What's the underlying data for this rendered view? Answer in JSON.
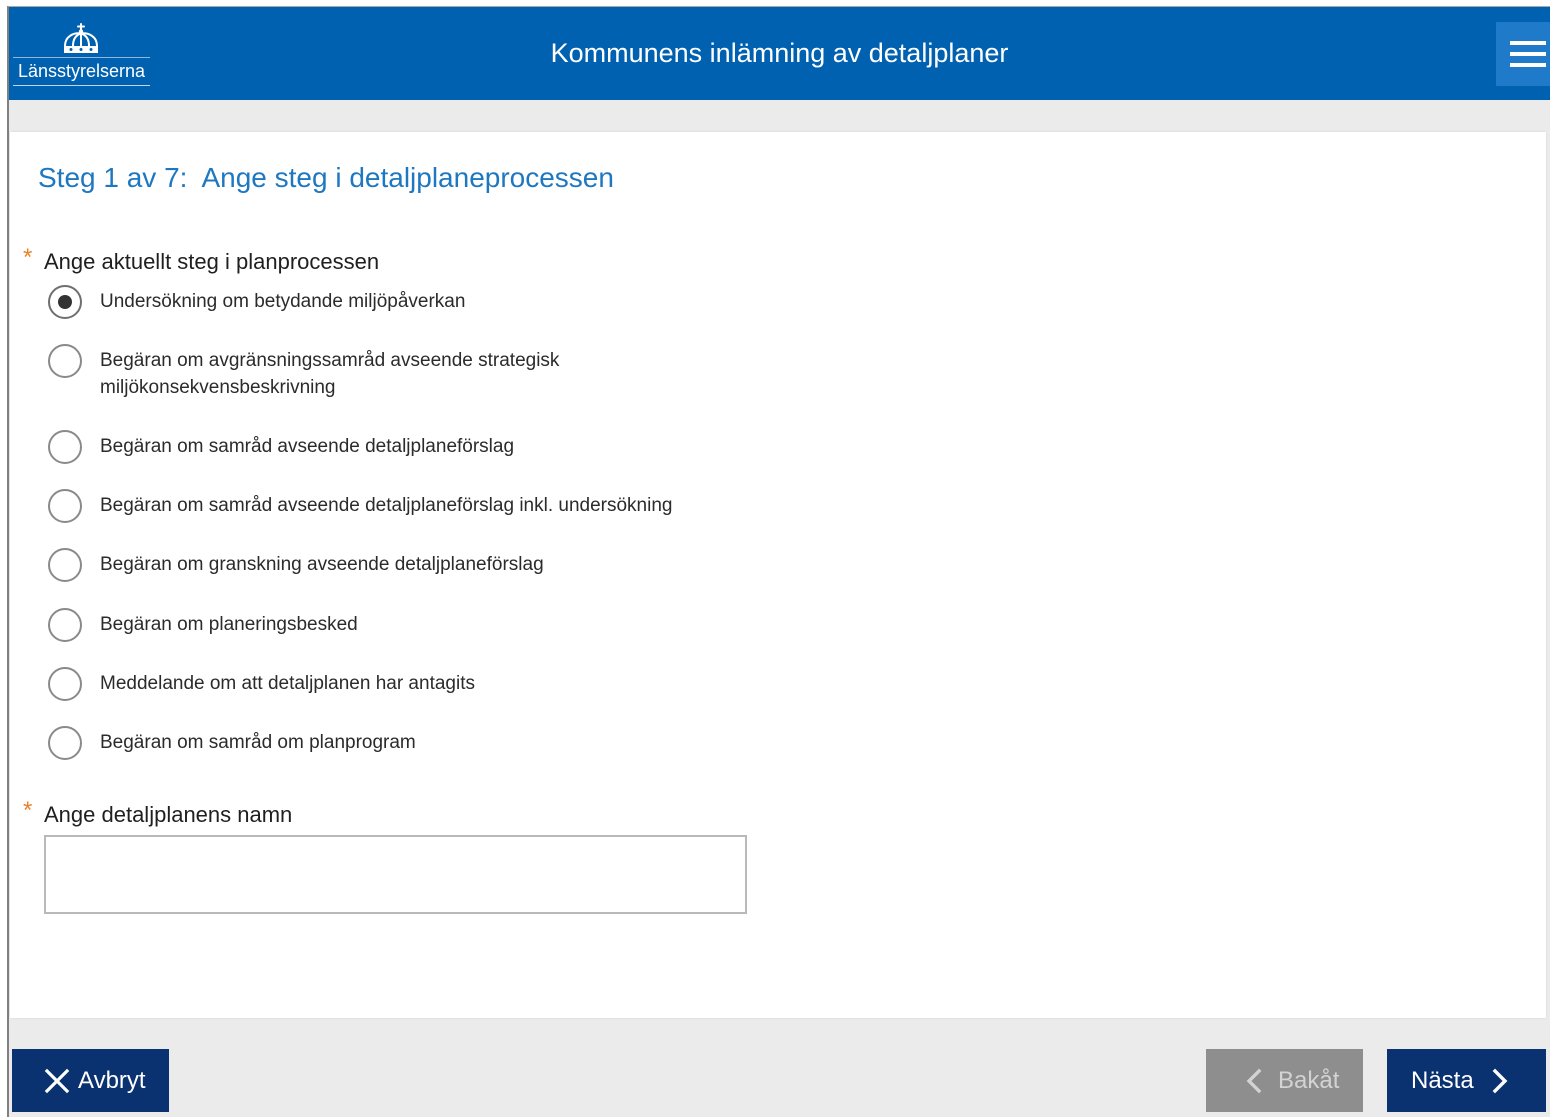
{
  "header": {
    "logo_icon": "crown-icon",
    "logo_text": "Länsstyrelserna",
    "title": "Kommunens inlämning av detaljplaner",
    "menu_icon": "hamburger-menu-icon"
  },
  "step": {
    "heading": "Steg 1 av 7:  Ange steg i detaljplaneprocessen"
  },
  "process_step": {
    "required_marker": "*",
    "label": "Ange aktuellt steg i planprocessen",
    "selected_index": 0,
    "options": [
      "Undersökning om betydande miljöpåverkan",
      "Begäran om avgränsningssamråd avseende strategisk miljökonsekvensbeskrivning",
      "Begäran om samråd avseende detaljplaneförslag",
      "Begäran om samråd avseende detaljplaneförslag inkl. undersökning",
      "Begäran om granskning avseende detaljplaneförslag",
      "Begäran om planeringsbesked",
      "Meddelande om att detaljplanen har antagits",
      "Begäran om samråd om planprogram"
    ]
  },
  "plan_name": {
    "required_marker": "*",
    "label": "Ange detaljplanens namn",
    "value": ""
  },
  "footer": {
    "cancel_icon": "close-icon",
    "cancel_label": "Avbryt",
    "back_icon": "chevron-left-icon",
    "back_label": "Bakåt",
    "back_disabled": true,
    "next_label": "Nästa",
    "next_icon": "chevron-right-icon"
  },
  "colors": {
    "header_bg": "#0061b0",
    "menu_bg": "#1f7bca",
    "heading": "#1e78c1",
    "required": "#e8832a",
    "primary_button": "#0b3270",
    "disabled_button": "#8e8e8e"
  }
}
